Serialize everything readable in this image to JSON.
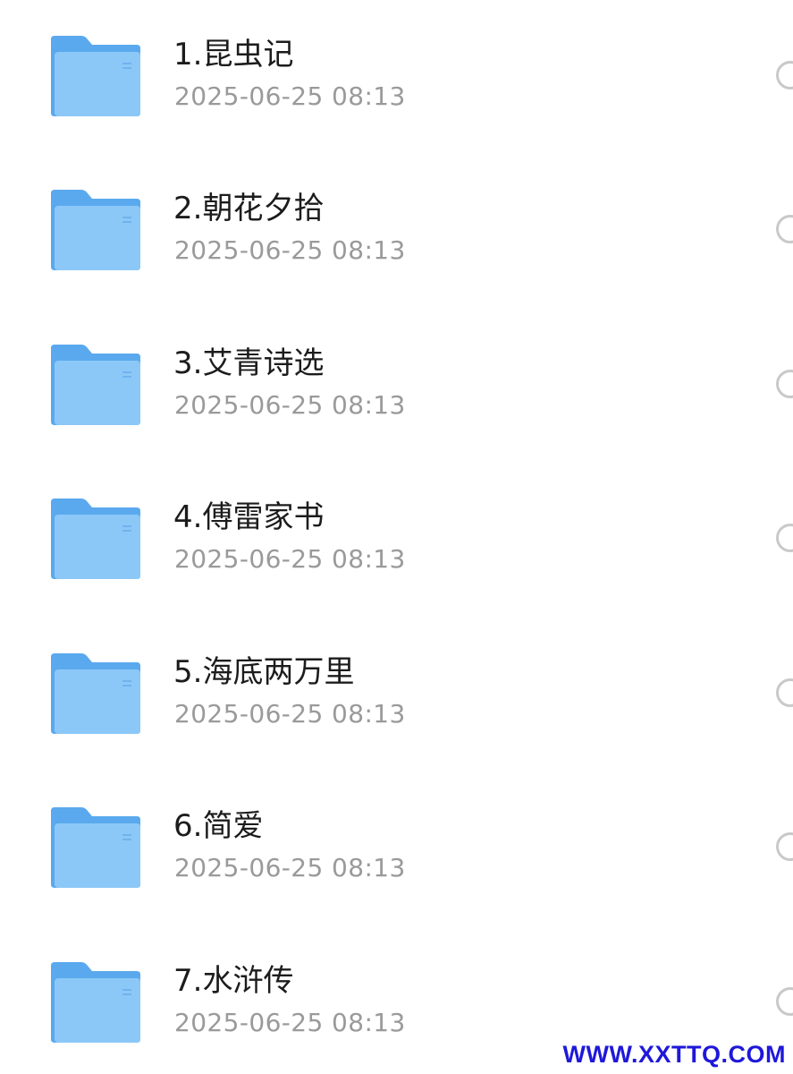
{
  "files": [
    {
      "name": "1.昆虫记",
      "date": "2025-06-25 08:13",
      "icon": "folder-icon"
    },
    {
      "name": "2.朝花夕拾",
      "date": "2025-06-25 08:13",
      "icon": "folder-icon"
    },
    {
      "name": "3.艾青诗选",
      "date": "2025-06-25 08:13",
      "icon": "folder-icon"
    },
    {
      "name": "4.傅雷家书",
      "date": "2025-06-25 08:13",
      "icon": "folder-icon"
    },
    {
      "name": "5.海底两万里",
      "date": "2025-06-25 08:13",
      "icon": "folder-icon"
    },
    {
      "name": "6.简爱",
      "date": "2025-06-25 08:13",
      "icon": "folder-icon"
    },
    {
      "name": "7.水浒传",
      "date": "2025-06-25 08:13",
      "icon": "folder-icon"
    }
  ],
  "watermark": "WWW.XXTTQ.COM",
  "colors": {
    "folder_back": "#5aa9ee",
    "folder_front": "#8cc8f7",
    "name_text": "#1c1c1c",
    "date_text": "#9a9a9a",
    "radio_border": "#c9c9c9",
    "watermark": "#1f18d9"
  }
}
